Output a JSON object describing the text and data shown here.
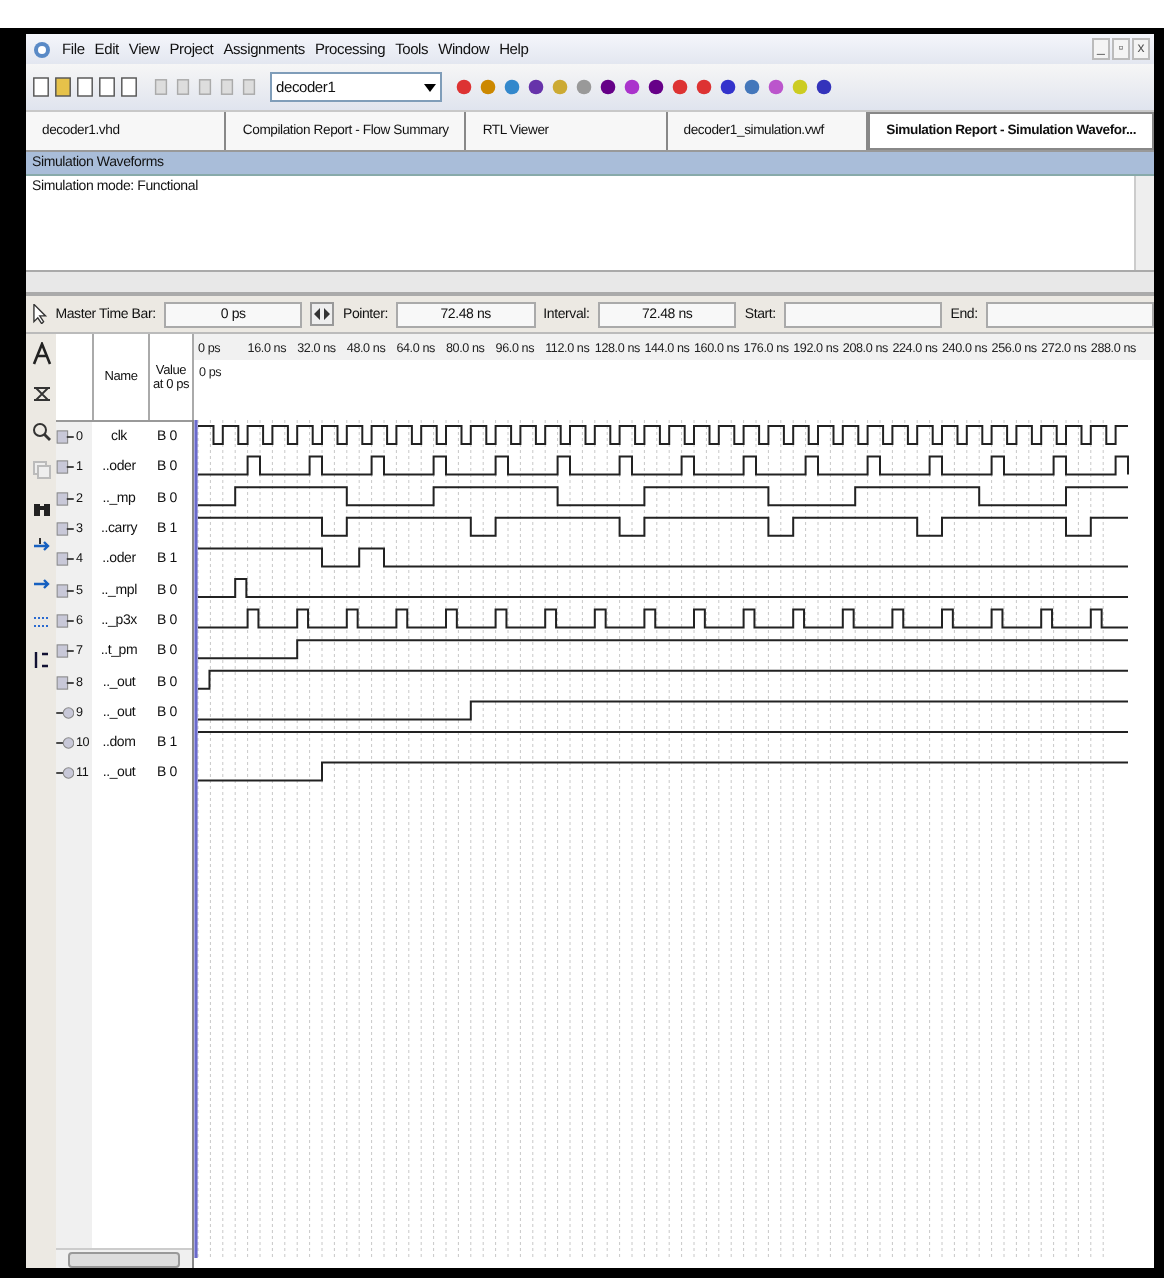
{
  "menu": [
    "File",
    "Edit",
    "View",
    "Project",
    "Assignments",
    "Processing",
    "Tools",
    "Window",
    "Help"
  ],
  "window_controls": [
    "_",
    "▫",
    "x"
  ],
  "toolbar": {
    "project": "decoder1"
  },
  "tabs": [
    {
      "label": "decoder1.vhd",
      "selected": false
    },
    {
      "label": "Compilation Report - Flow Summary",
      "selected": false
    },
    {
      "label": "RTL Viewer",
      "selected": false
    },
    {
      "label": "decoder1_simulation.vwf",
      "selected": false
    },
    {
      "label": "Simulation Report - Simulation Wavefor...",
      "selected": true
    }
  ],
  "section": {
    "title": "Simulation Waveforms",
    "mode": "Simulation mode: Functional"
  },
  "time_bar": {
    "master_label": "Master Time Bar:",
    "master_value": "0 ps",
    "pointer_label": "Pointer:",
    "pointer_value": "72.48 ns",
    "interval_label": "Interval:",
    "interval_value": "72.48 ns",
    "start_label": "Start:",
    "end_label": "End:"
  },
  "columns": {
    "name": "Name",
    "value": "Value at 0 ps"
  },
  "ticks": [
    "0 ps",
    "16.0 ns",
    "32.0 ns",
    "48.0 ns",
    "64.0 ns",
    "80.0 ns",
    "96.0 ns",
    "112.0 ns",
    "128.0 ns",
    "144.0 ns",
    "160.0 ns",
    "176.0 ns",
    "192.0 ns",
    "208.0 ns",
    "224.0 ns",
    "240.0 ns",
    "256.0 ns",
    "272.0 ns",
    "288.0 ns"
  ],
  "cursor_label": "0 ps",
  "signals": [
    {
      "index": "0",
      "kind": "input",
      "name": "clk",
      "value": "B 0"
    },
    {
      "index": "1",
      "kind": "input",
      "name": "..oder",
      "value": "B 0"
    },
    {
      "index": "2",
      "kind": "input",
      "name": ".._mp",
      "value": "B 0"
    },
    {
      "index": "3",
      "kind": "input",
      "name": "..carry",
      "value": "B 1"
    },
    {
      "index": "4",
      "kind": "input",
      "name": "..oder",
      "value": "B 1"
    },
    {
      "index": "5",
      "kind": "input",
      "name": ".._mpl",
      "value": "B 0"
    },
    {
      "index": "6",
      "kind": "input",
      "name": ".._p3x",
      "value": "B 0"
    },
    {
      "index": "7",
      "kind": "input",
      "name": "..t_pm",
      "value": "B 0"
    },
    {
      "index": "8",
      "kind": "input",
      "name": ".._out",
      "value": "B 0"
    },
    {
      "index": "9",
      "kind": "output",
      "name": ".._out",
      "value": "B 0"
    },
    {
      "index": "10",
      "kind": "output",
      "name": "..dom",
      "value": "B 1"
    },
    {
      "index": "11",
      "kind": "output",
      "name": ".._out",
      "value": "B 0"
    }
  ]
}
